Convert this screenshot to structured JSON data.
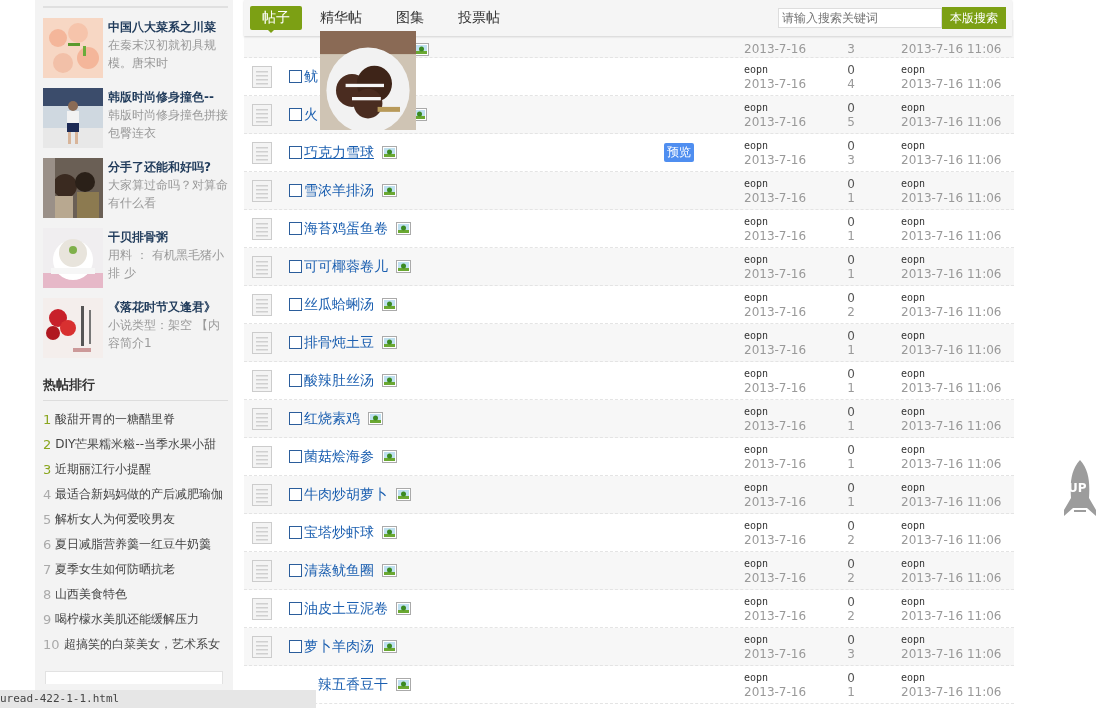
{
  "sidebar": {
    "featured": [
      {
        "title": "中国八大菜系之川菜",
        "desc": "在秦末汉初就初具规模。唐宋时"
      },
      {
        "title": "韩版时尚修身撞色--",
        "desc": "韩版时尚修身撞色拼接包臀连衣"
      },
      {
        "title": "分手了还能和好吗?",
        "desc": "大家算过命吗？对算命有什么看"
      },
      {
        "title": "干贝排骨粥",
        "desc": "用料 ： 有机黑毛猪小排 少"
      },
      {
        "title": "《落花时节又逢君》",
        "desc": "小说类型：架空 【内容简介1"
      }
    ],
    "hot_title": "热帖排行",
    "hot": [
      {
        "rank": "1",
        "title": "酸甜开胃的一糖醋里脊"
      },
      {
        "rank": "2",
        "title": "DIY芒果糯米糍--当季水果小甜"
      },
      {
        "rank": "3",
        "title": "近期丽江行小提醒"
      },
      {
        "rank": "4",
        "title": "最适合新妈妈做的产后减肥瑜伽"
      },
      {
        "rank": "5",
        "title": "解析女人为何爱咬男友"
      },
      {
        "rank": "6",
        "title": "夏日减脂营养羹一红豆牛奶羹"
      },
      {
        "rank": "7",
        "title": "夏季女生如何防晒抗老"
      },
      {
        "rank": "8",
        "title": "山西美食特色"
      },
      {
        "rank": "9",
        "title": "喝柠檬水美肌还能缓解压力"
      },
      {
        "rank": "10",
        "title": "超搞笑的白菜美女，艺术系女"
      }
    ]
  },
  "tabs": [
    {
      "label": "帖子",
      "selected": true
    },
    {
      "label": "精华帖",
      "selected": false
    },
    {
      "label": "图集",
      "selected": false
    },
    {
      "label": "投票帖",
      "selected": false
    }
  ],
  "search": {
    "placeholder": "请输入搜索关键词",
    "button": "本版搜索"
  },
  "threads": [
    {
      "kind": "partial",
      "has_image_icon": true,
      "date": "2013-7-16",
      "views": "3",
      "last_time": "2013-7-16 11:06"
    },
    {
      "kind": "covered",
      "title": "鱿",
      "checked": false,
      "has_image_icon": false,
      "author": "eopn",
      "date": "2013-7-16",
      "replies": "0",
      "views": "4",
      "last_author": "eopn",
      "last_time": "2013-7-16 11:06"
    },
    {
      "kind": "covered",
      "title": "火",
      "checked": false,
      "has_image_icon": true,
      "author": "eopn",
      "date": "2013-7-16",
      "replies": "0",
      "views": "5",
      "last_author": "eopn",
      "last_time": "2013-7-16 11:06"
    },
    {
      "kind": "normal",
      "title": "巧克力雪球",
      "checked": false,
      "hovered": true,
      "has_image_icon": true,
      "preview": "预览",
      "author": "eopn",
      "date": "2013-7-16",
      "replies": "0",
      "views": "3",
      "last_author": "eopn",
      "last_time": "2013-7-16 11:06"
    },
    {
      "kind": "normal",
      "title": "雪浓羊排汤",
      "checked": false,
      "has_image_icon": true,
      "author": "eopn",
      "date": "2013-7-16",
      "replies": "0",
      "views": "1",
      "last_author": "eopn",
      "last_time": "2013-7-16 11:06"
    },
    {
      "kind": "normal",
      "title": "海苔鸡蛋鱼卷",
      "checked": false,
      "has_image_icon": true,
      "author": "eopn",
      "date": "2013-7-16",
      "replies": "0",
      "views": "1",
      "last_author": "eopn",
      "last_time": "2013-7-16 11:06"
    },
    {
      "kind": "normal",
      "title": "可可椰蓉卷儿",
      "checked": false,
      "has_image_icon": true,
      "author": "eopn",
      "date": "2013-7-16",
      "replies": "0",
      "views": "1",
      "last_author": "eopn",
      "last_time": "2013-7-16 11:06"
    },
    {
      "kind": "normal",
      "title": "丝瓜蛤蜊汤",
      "checked": false,
      "has_image_icon": true,
      "author": "eopn",
      "date": "2013-7-16",
      "replies": "0",
      "views": "2",
      "last_author": "eopn",
      "last_time": "2013-7-16 11:06"
    },
    {
      "kind": "normal",
      "title": "排骨炖土豆",
      "checked": false,
      "has_image_icon": true,
      "author": "eopn",
      "date": "2013-7-16",
      "replies": "0",
      "views": "1",
      "last_author": "eopn",
      "last_time": "2013-7-16 11:06"
    },
    {
      "kind": "normal",
      "title": "酸辣肚丝汤",
      "checked": false,
      "has_image_icon": true,
      "author": "eopn",
      "date": "2013-7-16",
      "replies": "0",
      "views": "1",
      "last_author": "eopn",
      "last_time": "2013-7-16 11:06"
    },
    {
      "kind": "normal",
      "title": "红烧素鸡",
      "checked": false,
      "has_image_icon": true,
      "author": "eopn",
      "date": "2013-7-16",
      "replies": "0",
      "views": "1",
      "last_author": "eopn",
      "last_time": "2013-7-16 11:06"
    },
    {
      "kind": "normal",
      "title": "菌菇烩海参",
      "checked": false,
      "has_image_icon": true,
      "author": "eopn",
      "date": "2013-7-16",
      "replies": "0",
      "views": "1",
      "last_author": "eopn",
      "last_time": "2013-7-16 11:06"
    },
    {
      "kind": "normal",
      "title": "牛肉炒胡萝卜",
      "checked": false,
      "has_image_icon": true,
      "author": "eopn",
      "date": "2013-7-16",
      "replies": "0",
      "views": "1",
      "last_author": "eopn",
      "last_time": "2013-7-16 11:06"
    },
    {
      "kind": "normal",
      "title": "宝塔炒虾球",
      "checked": false,
      "has_image_icon": true,
      "author": "eopn",
      "date": "2013-7-16",
      "replies": "0",
      "views": "2",
      "last_author": "eopn",
      "last_time": "2013-7-16 11:06"
    },
    {
      "kind": "normal",
      "title": "清蒸鱿鱼圈",
      "checked": false,
      "has_image_icon": true,
      "author": "eopn",
      "date": "2013-7-16",
      "replies": "0",
      "views": "2",
      "last_author": "eopn",
      "last_time": "2013-7-16 11:06"
    },
    {
      "kind": "normal",
      "title": "油皮土豆泥卷",
      "checked": false,
      "has_image_icon": true,
      "author": "eopn",
      "date": "2013-7-16",
      "replies": "0",
      "views": "2",
      "last_author": "eopn",
      "last_time": "2013-7-16 11:06"
    },
    {
      "kind": "normal",
      "title": "萝卜羊肉汤",
      "checked": false,
      "has_image_icon": true,
      "author": "eopn",
      "date": "2013-7-16",
      "replies": "0",
      "views": "3",
      "last_author": "eopn",
      "last_time": "2013-7-16 11:06"
    },
    {
      "kind": "cut",
      "title": "辣五香豆干",
      "has_image_icon": true,
      "author": "eopn",
      "date": "2013-7-16",
      "replies": "0",
      "views": "1",
      "last_author": "eopn",
      "last_time": "2013-7-16 11:06"
    }
  ],
  "status_bar": "uread-422-1-1.html",
  "back_to_top": "UP"
}
